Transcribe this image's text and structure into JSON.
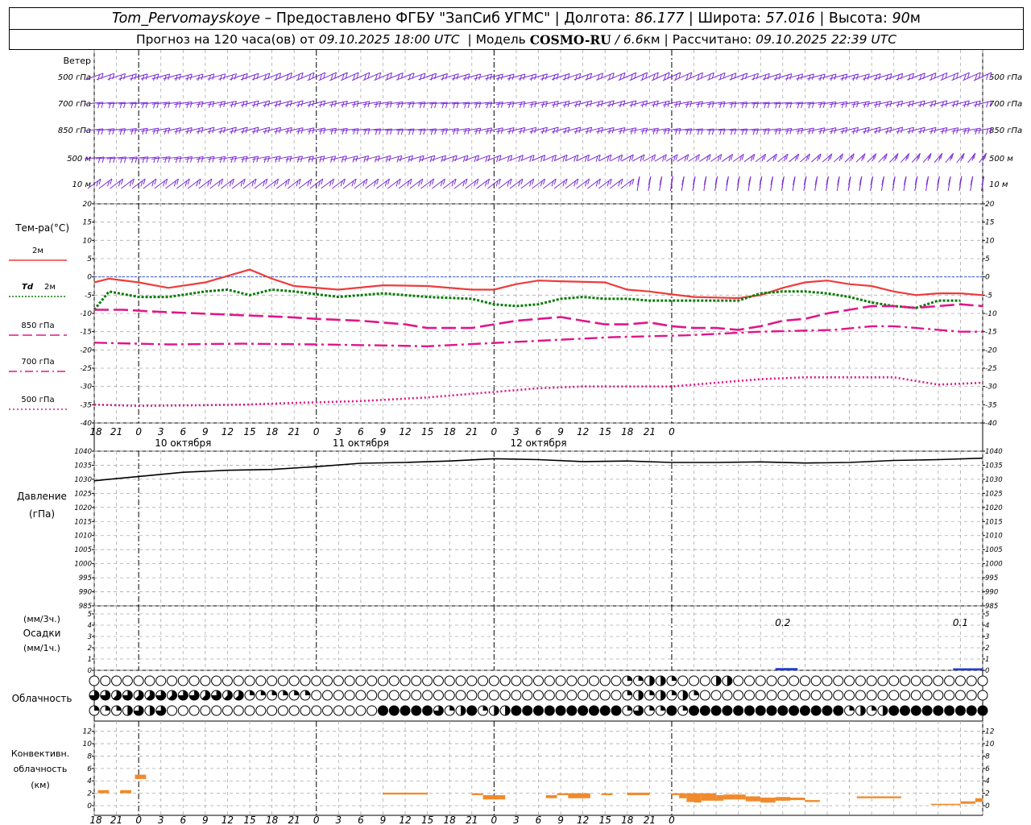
{
  "header": {
    "station": "Tom_Pervomayskoye",
    "provided_by": "– Предоставлено ФГБУ \"ЗапСиб УГМС\"",
    "lon_label": "Долгота:",
    "lon_value": "86.177",
    "lat_label": "Широта:",
    "lat_value": "57.016",
    "alt_label": "Высота:",
    "alt_value": "90",
    "alt_unit": "м",
    "forecast_prefix": "Прогноз на 120 часа(ов) от",
    "forecast_time": "09.10.2025 18:00 UTC",
    "model_label": "Модель",
    "model_name": "COSMO-RU",
    "model_res": "/ 6.6",
    "model_res_unit": "км",
    "calc_label": "Рассчитано:",
    "calc_time": "09.10.2025 22:39 UTC"
  },
  "colors": {
    "t2m": "#ef3b3b",
    "td2m": "#0a7a0a",
    "t850": "#e0168a",
    "t700": "#e0168a",
    "t500": "#e0168a",
    "pressure": "#000000",
    "precip": "#1e3cd8",
    "convective": "#f08a2c",
    "wind": "#7a2bd6",
    "zero_line": "#3a5bd8"
  },
  "time_axis": {
    "hour_labels": [
      "18",
      "21",
      "0",
      "3",
      "6",
      "9",
      "12",
      "15",
      "18",
      "21",
      "0",
      "3",
      "6",
      "9",
      "12",
      "15",
      "18",
      "21",
      "0",
      "3",
      "6",
      "9",
      "12",
      "15",
      "18",
      "21",
      "0"
    ],
    "day_labels": [
      "10 октября",
      "11 октября",
      "12 октября"
    ]
  },
  "wind_panel": {
    "title": "Ветер",
    "levels": [
      "500 гПа",
      "700 гПа",
      "850 гПа",
      "500 м",
      "10 м"
    ]
  },
  "temp_panel": {
    "title": "Тем-ра(°С)",
    "legend": [
      {
        "key": "t2m",
        "label": "2м",
        "color": "#ef3b3b",
        "style": "solid"
      },
      {
        "key": "td2m",
        "label": "Td",
        "label2": "2м",
        "color": "#0a7a0a",
        "style": "dotted"
      },
      {
        "key": "t850",
        "label": "850 гПа",
        "color": "#e0168a",
        "style": "dash"
      },
      {
        "key": "t700",
        "label": "700 гПа",
        "color": "#e0168a",
        "style": "dashdot"
      },
      {
        "key": "t500",
        "label": "500 гПа",
        "color": "#e0168a",
        "style": "dot"
      }
    ],
    "ticks": [
      "20",
      "15",
      "10",
      "5",
      "0",
      "-5",
      "-10",
      "-15",
      "-20",
      "-25",
      "-30",
      "-35",
      "-40"
    ]
  },
  "pressure_panel": {
    "title": "Давление",
    "unit": "(гПа)",
    "ticks": [
      "1040",
      "1035",
      "1030",
      "1025",
      "1020",
      "1015",
      "1010",
      "1005",
      "1000",
      "995",
      "990",
      "985"
    ]
  },
  "precip_panel": {
    "unit_3h": "(мм/3ч.)",
    "title": "Осадки",
    "unit_1h": "(мм/1ч.)",
    "ticks": [
      "5",
      "4",
      "3",
      "2",
      "1",
      "0"
    ],
    "annotations": [
      {
        "t": 93,
        "text": "0.2"
      },
      {
        "t": 117,
        "text": "0.1"
      }
    ]
  },
  "cloud_panel": {
    "title": "Облачность"
  },
  "conv_panel": {
    "title1": "Конвективн.",
    "title2": "облачность",
    "unit": "(км)",
    "ticks": [
      "12",
      "10",
      "8",
      "6",
      "4",
      "2",
      "0"
    ]
  },
  "chart_data": {
    "type": "line",
    "x_unit": "hours from 09.10.2025 18:00 UTC",
    "temperature": {
      "ylim": [
        -40,
        20
      ],
      "series": [
        {
          "name": "2м",
          "x": [
            0,
            2,
            6,
            10,
            15,
            21,
            24,
            27,
            33,
            39,
            45,
            51,
            54,
            57,
            60,
            63,
            69,
            72,
            75,
            78,
            81,
            87,
            90,
            93,
            96,
            99,
            102,
            105,
            108,
            111,
            114,
            117,
            120
          ],
          "y": [
            -1.5,
            -0.5,
            -1.5,
            -3,
            -1.5,
            2,
            -0.5,
            -2.5,
            -3.5,
            -2.3,
            -2.5,
            -3.5,
            -3.5,
            -2,
            -1,
            -1.2,
            -1.5,
            -3.5,
            -4,
            -4.8,
            -5.5,
            -5.8,
            -5,
            -3,
            -1.5,
            -1,
            -2,
            -2.5,
            -4,
            -5,
            -4.5,
            -4.5,
            -5
          ]
        },
        {
          "name": "Td 2м",
          "x": [
            0,
            2,
            6,
            10,
            15,
            18,
            21,
            24,
            27,
            33,
            39,
            45,
            51,
            54,
            57,
            60,
            63,
            66,
            69,
            72,
            75,
            81,
            87,
            90,
            93,
            96,
            99,
            102,
            105,
            108,
            111,
            114,
            117,
            120
          ],
          "y": [
            -9,
            -4,
            -5.5,
            -5.5,
            -4,
            -3.5,
            -5,
            -3.5,
            -4,
            -5.5,
            -4.5,
            -5.5,
            -6,
            -7.5,
            -8,
            -7.5,
            -6,
            -5.5,
            -6,
            -6,
            -6.5,
            -6.5,
            -6.5,
            -4.5,
            -4,
            -4,
            -4.5,
            -5.5,
            -7,
            -8,
            -8.5,
            -6.5,
            -6.5
          ]
        },
        {
          "name": "850 гПа",
          "x": [
            0,
            4,
            8,
            14,
            20,
            26,
            30,
            36,
            42,
            45,
            48,
            51,
            54,
            57,
            60,
            63,
            66,
            69,
            72,
            75,
            78,
            81,
            84,
            87,
            90,
            93,
            96,
            99,
            102,
            105,
            108,
            111,
            114,
            117,
            120
          ],
          "y": [
            -9,
            -9,
            -9.5,
            -10,
            -10.5,
            -11,
            -11.5,
            -12,
            -13,
            -14,
            -14,
            -14,
            -13,
            -12,
            -11.5,
            -11,
            -12,
            -13,
            -13,
            -12.5,
            -13.5,
            -14,
            -14,
            -14.5,
            -13.5,
            -12,
            -11.5,
            -10,
            -9,
            -8,
            -8,
            -8.5,
            -8,
            -7.5,
            -8
          ]
        },
        {
          "name": "700 гПа",
          "x": [
            0,
            10,
            20,
            30,
            40,
            45,
            50,
            60,
            70,
            80,
            90,
            100,
            105,
            108,
            111,
            114,
            117,
            120
          ],
          "y": [
            -18,
            -18.5,
            -18.3,
            -18.5,
            -18.8,
            -19,
            -18.5,
            -17.5,
            -16.5,
            -16,
            -15,
            -14.5,
            -13.5,
            -13.5,
            -14,
            -14.5,
            -15,
            -15
          ]
        },
        {
          "name": "500 гПа",
          "x": [
            0,
            6,
            12,
            20,
            27,
            36,
            45,
            54,
            60,
            66,
            72,
            78,
            84,
            90,
            96,
            102,
            108,
            114,
            120
          ],
          "y": [
            -35,
            -35.3,
            -35.2,
            -35,
            -34.5,
            -34,
            -33,
            -31.5,
            -30.5,
            -30,
            -30,
            -30,
            -29,
            -28,
            -27.5,
            -27.5,
            -27.5,
            -29.5,
            -29
          ]
        }
      ]
    },
    "pressure": {
      "ylim": [
        985,
        1040
      ],
      "x": [
        0,
        6,
        12,
        18,
        24,
        30,
        36,
        42,
        48,
        54,
        60,
        66,
        72,
        78,
        84,
        90,
        96,
        102,
        108,
        114,
        120
      ],
      "y": [
        1029.5,
        1031,
        1032.5,
        1033.2,
        1033.5,
        1034.5,
        1035.7,
        1036,
        1036.5,
        1037.3,
        1037,
        1036.3,
        1036.5,
        1036,
        1036,
        1036.2,
        1035.8,
        1036,
        1036.7,
        1037,
        1037.5
      ]
    },
    "precipitation": {
      "ylim": [
        0,
        5
      ],
      "bars": [
        {
          "t0": 92,
          "t1": 95,
          "value": 0.2
        },
        {
          "t0": 116,
          "t1": 120,
          "value": 0.1
        }
      ]
    },
    "convective_cloud": {
      "ylim": [
        0,
        13
      ],
      "bars": [
        {
          "t0": 0.5,
          "t1": 2,
          "base": 2.0,
          "top": 2.5
        },
        {
          "t0": 3.5,
          "t1": 5,
          "base": 2.0,
          "top": 2.5
        },
        {
          "t0": 5.5,
          "t1": 7,
          "base": 4.3,
          "top": 5.0
        },
        {
          "t0": 39,
          "t1": 45,
          "base": 1.8,
          "top": 2.1
        },
        {
          "t0": 51,
          "t1": 52.5,
          "base": 1.7,
          "top": 2.0
        },
        {
          "t0": 52.5,
          "t1": 55.5,
          "base": 1.0,
          "top": 1.7
        },
        {
          "t0": 61,
          "t1": 62.5,
          "base": 1.2,
          "top": 1.7
        },
        {
          "t0": 62.5,
          "t1": 64,
          "base": 1.7,
          "top": 2.0
        },
        {
          "t0": 64,
          "t1": 67,
          "base": 1.2,
          "top": 2.0
        },
        {
          "t0": 68.5,
          "t1": 70,
          "base": 1.7,
          "top": 2.0
        },
        {
          "t0": 72,
          "t1": 75,
          "base": 1.7,
          "top": 2.1
        },
        {
          "t0": 78,
          "t1": 79,
          "base": 1.7,
          "top": 2.0
        },
        {
          "t0": 79,
          "t1": 80,
          "base": 1.2,
          "top": 2.0
        },
        {
          "t0": 80,
          "t1": 81,
          "base": 0.6,
          "top": 2.0
        },
        {
          "t0": 81,
          "t1": 82,
          "base": 0.5,
          "top": 2.0
        },
        {
          "t0": 82,
          "t1": 84,
          "base": 0.8,
          "top": 2.0
        },
        {
          "t0": 84,
          "t1": 85,
          "base": 0.8,
          "top": 1.7
        },
        {
          "t0": 85,
          "t1": 88,
          "base": 1.0,
          "top": 1.8
        },
        {
          "t0": 88,
          "t1": 90,
          "base": 0.7,
          "top": 1.5
        },
        {
          "t0": 90,
          "t1": 92,
          "base": 0.5,
          "top": 1.3
        },
        {
          "t0": 92,
          "t1": 94,
          "base": 0.8,
          "top": 1.4
        },
        {
          "t0": 94,
          "t1": 96,
          "base": 0.9,
          "top": 1.3
        },
        {
          "t0": 96,
          "t1": 98,
          "base": 0.6,
          "top": 0.9
        },
        {
          "t0": 103,
          "t1": 109,
          "base": 1.2,
          "top": 1.5
        },
        {
          "t0": 113,
          "t1": 117,
          "base": 0.1,
          "top": 0.3
        },
        {
          "t0": 117,
          "t1": 119,
          "base": 0.3,
          "top": 0.7
        },
        {
          "t0": 119,
          "t1": 120,
          "base": 0.6,
          "top": 1.2
        }
      ]
    },
    "cloud_cover": {
      "rows": [
        "upper",
        "middle",
        "lower"
      ],
      "upper_eighths": "000000000000000000000000000000000000000000000000000000000000000000000000000000000000000000000000000000000000000000000000",
      "middle_eighths": "",
      "lower_eighths": ""
    }
  }
}
